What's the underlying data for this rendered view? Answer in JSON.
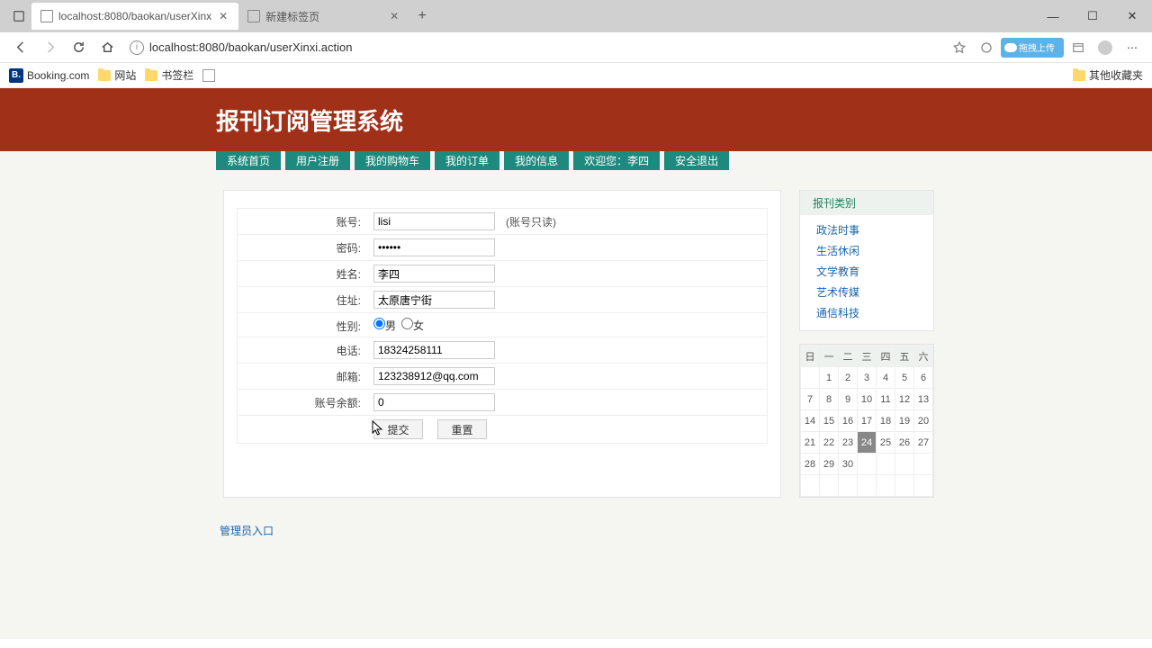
{
  "browser": {
    "tabs": [
      {
        "title": "localhost:8080/baokan/userXinx",
        "active": true
      },
      {
        "title": "新建标签页",
        "active": false
      }
    ],
    "url": "localhost:8080/baokan/userXinxi.action",
    "winctrl": {
      "min": "—",
      "max": "☐",
      "close": "✕"
    }
  },
  "bookmarks": {
    "items": [
      {
        "icon": "B",
        "label": "Booking.com"
      },
      {
        "icon": "folder",
        "label": "网站"
      },
      {
        "icon": "folder",
        "label": "书签栏"
      },
      {
        "icon": "page",
        "label": ""
      }
    ],
    "right": "其他收藏夹"
  },
  "site": {
    "title": "报刊订阅管理系统",
    "menu": [
      "系统首页",
      "用户注册",
      "我的购物车",
      "我的订单",
      "我的信息",
      "欢迎您：李四",
      "安全退出"
    ],
    "adminLink": "管理员入口"
  },
  "form": {
    "labels": {
      "account": "账号:",
      "password": "密码:",
      "name": "姓名:",
      "address": "住址:",
      "gender": "性别:",
      "male": "男",
      "female": "女",
      "phone": "电话:",
      "email": "邮箱:",
      "balance": "账号余额:",
      "submit": "提交",
      "reset": "重置"
    },
    "values": {
      "account": "lisi",
      "password": "••••••",
      "name": "李四",
      "address": "太原唐宁街",
      "phone": "18324258111",
      "email": "123238912@qq.com",
      "balance": "0"
    },
    "hint": "(账号只读)"
  },
  "categories": {
    "header": "报刊类别",
    "items": [
      "政法时事",
      "生活休闲",
      "文学教育",
      "艺术传媒",
      "通信科技"
    ]
  },
  "calendar": {
    "dow": [
      "日",
      "一",
      "二",
      "三",
      "四",
      "五",
      "六"
    ],
    "weeks": [
      [
        "",
        "1",
        "2",
        "3",
        "4",
        "5",
        "6"
      ],
      [
        "7",
        "8",
        "9",
        "10",
        "11",
        "12",
        "13"
      ],
      [
        "14",
        "15",
        "16",
        "17",
        "18",
        "19",
        "20"
      ],
      [
        "21",
        "22",
        "23",
        "24",
        "25",
        "26",
        "27"
      ],
      [
        "28",
        "29",
        "30",
        "",
        "",
        "",
        ""
      ],
      [
        "",
        "",
        "",
        "",
        "",
        "",
        ""
      ]
    ],
    "today": "24"
  }
}
